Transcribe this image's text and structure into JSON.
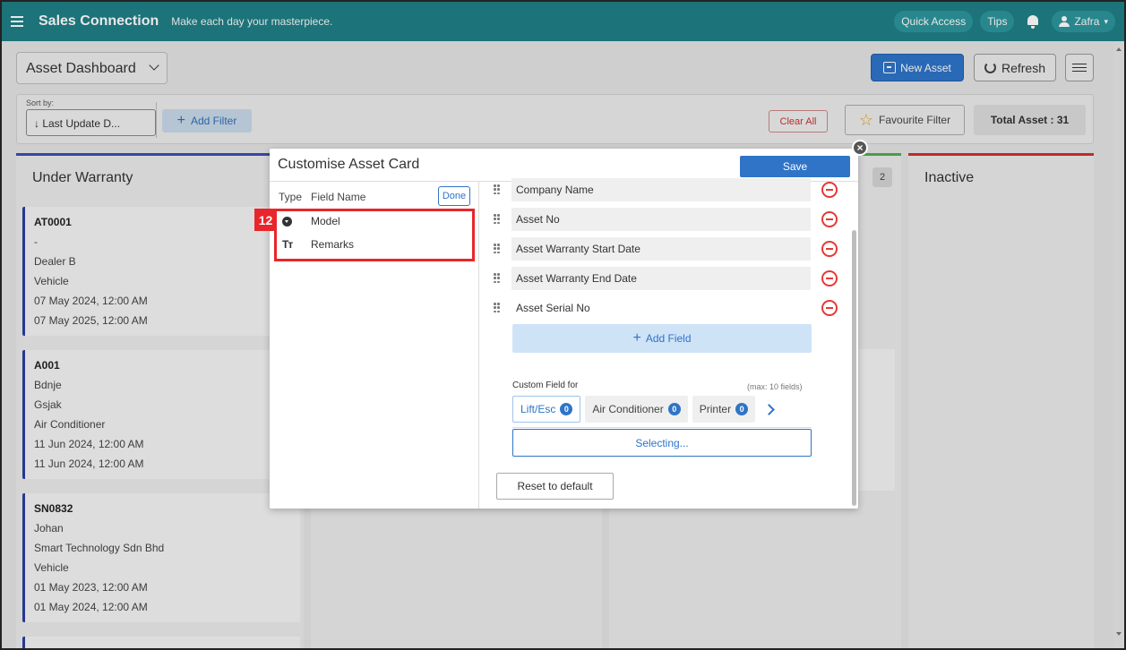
{
  "topbar": {
    "brand": "Sales Connection",
    "tagline": "Make each day your masterpiece.",
    "quick_access": "Quick Access",
    "tips": "Tips",
    "user": "Zafra"
  },
  "page": {
    "dashboard_select": "Asset Dashboard",
    "new_asset": "New Asset",
    "refresh": "Refresh",
    "sort_by_label": "Sort by:",
    "sort_value": "↓ Last Update D...",
    "add_filter": "Add Filter",
    "clear_all": "Clear All",
    "favourite_filter": "Favourite Filter",
    "total_asset": "Total Asset : 31"
  },
  "columns": [
    {
      "title": "Under Warranty",
      "color": "#3d4db7"
    },
    {
      "title": "",
      "badge": "2",
      "color": "#4caf50"
    },
    {
      "title": "Inactive",
      "color": "#d32f2f"
    }
  ],
  "cards": [
    {
      "lines": [
        "AT0001",
        "-",
        "Dealer B",
        "Vehicle",
        "07 May 2024, 12:00 AM",
        "07 May 2025, 12:00 AM"
      ]
    },
    {
      "lines": [
        "A001",
        "Bdnje",
        "Gsjak",
        "Air Conditioner",
        "11 Jun 2024, 12:00 AM",
        "11 Jun 2024, 12:00 AM"
      ]
    },
    {
      "lines": [
        "SN0832",
        "Johan",
        "Smart Technology Sdn Bhd",
        "Vehicle",
        "01 May 2023, 12:00 AM",
        "01 May 2024, 12:00 AM"
      ]
    }
  ],
  "modal": {
    "title": "Customise Asset Card",
    "save": "Save",
    "close": "×",
    "left": {
      "type_header": "Type",
      "field_header": "Field Name",
      "done": "Done",
      "step_badge": "12",
      "items": [
        {
          "type_icon": "dropdown-icon",
          "name": "Model"
        },
        {
          "type_icon": "text-icon",
          "name": "Remarks"
        }
      ]
    },
    "fields": [
      "Company Name",
      "Asset No",
      "Asset Warranty Start Date",
      "Asset Warranty End Date",
      "Asset Serial No"
    ],
    "add_field": "Add Field",
    "custom_field_label": "Custom Field for",
    "custom_field_max": "(max: 10 fields)",
    "custom_tabs": [
      {
        "label": "Lift/Esc",
        "count": "0",
        "active": true
      },
      {
        "label": "Air Conditioner",
        "count": "0",
        "active": false
      },
      {
        "label": "Printer",
        "count": "0",
        "active": false
      }
    ],
    "selecting": "Selecting...",
    "reset": "Reset to default"
  }
}
